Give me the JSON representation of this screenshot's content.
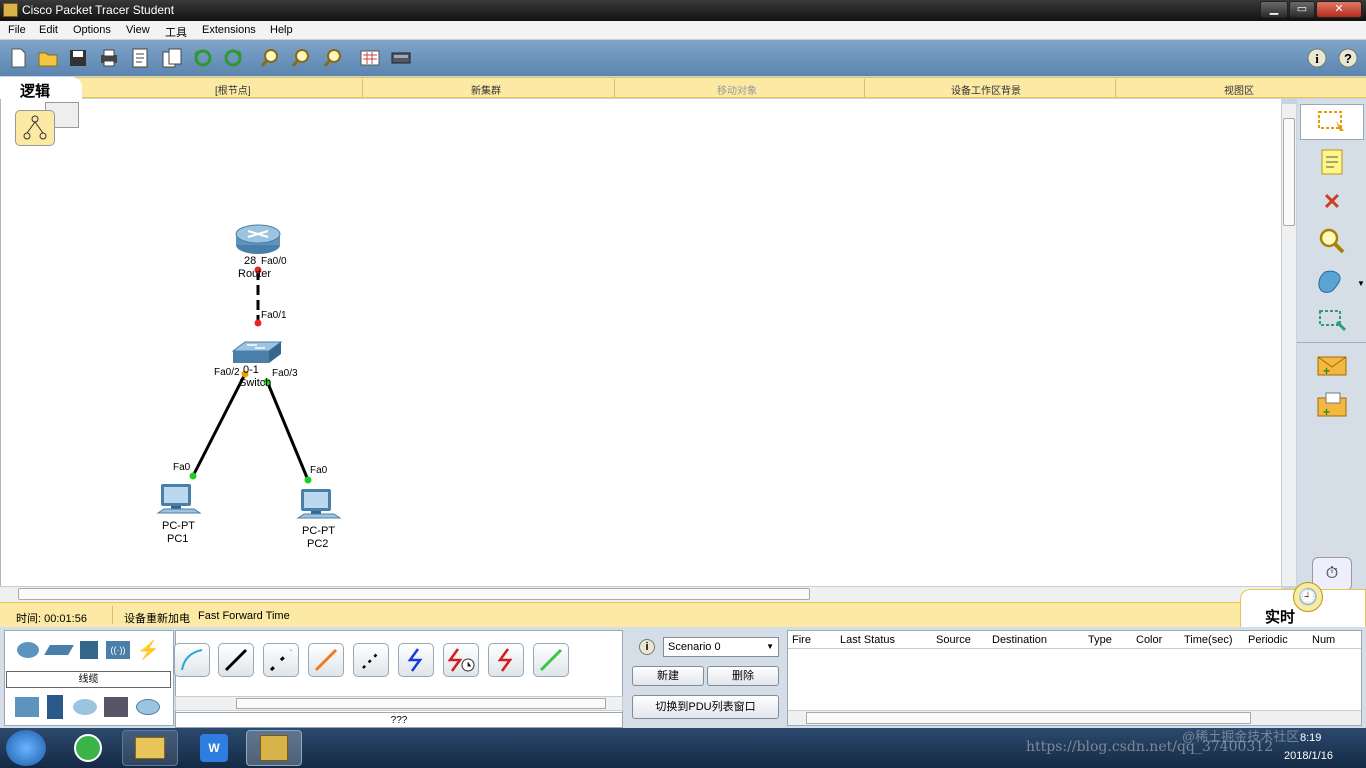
{
  "window": {
    "title": "Cisco Packet Tracer Student"
  },
  "menu": [
    "File",
    "Edit",
    "Options",
    "View",
    "工具",
    "Extensions",
    "Help"
  ],
  "navbar": {
    "logic_tab": "逻辑",
    "items": [
      "[根节点]",
      "新集群",
      "移动对象",
      "设备工作区背景",
      "视图区"
    ]
  },
  "topology": {
    "devices": [
      {
        "id": "router",
        "model": "28",
        "name": "Router",
        "icon": "router-icon"
      },
      {
        "id": "switch",
        "model": "0-1",
        "name": "Switch",
        "icon": "switch-icon"
      },
      {
        "id": "pc1",
        "model": "PC-PT",
        "name": "PC1",
        "icon": "pc-icon"
      },
      {
        "id": "pc2",
        "model": "PC-PT",
        "name": "PC2",
        "icon": "pc-icon"
      }
    ],
    "ports": {
      "router_fa00": "Fa0/0",
      "switch_fa01": "Fa0/1",
      "switch_fa02": "Fa0/2",
      "switch_fa03": "Fa0/3",
      "pc1_fa0": "Fa0",
      "pc2_fa0": "Fa0"
    },
    "link_colors": {
      "up": "#22cc22",
      "down": "#ee2222",
      "amber": "#f2a000"
    }
  },
  "statusbar": {
    "time_label": "时间: 00:01:56",
    "power_cycle": "设备重新加电",
    "fast_forward": "Fast Forward Time",
    "mode_tab": "实时"
  },
  "device_panel": {
    "category_label": "线缆",
    "selection_label": "???"
  },
  "scenario": {
    "selected": "Scenario 0",
    "new_btn": "新建",
    "delete_btn": "删除",
    "toggle_pdu_btn": "切换到PDU列表窗口"
  },
  "pdu_table": {
    "columns": [
      "Fire",
      "Last Status",
      "Source",
      "Destination",
      "Type",
      "Color",
      "Time(sec)",
      "Periodic",
      "Num"
    ]
  },
  "taskbar": {
    "clock_time": "8:19",
    "clock_date": "2018/1/16",
    "watermark": "https://blog.csdn.net/qq_37400312",
    "watermark2": "@稀土掘金技术社区"
  },
  "colors": {
    "accent": "#5b85b0",
    "nav_yellow": "#fbe9a4"
  }
}
